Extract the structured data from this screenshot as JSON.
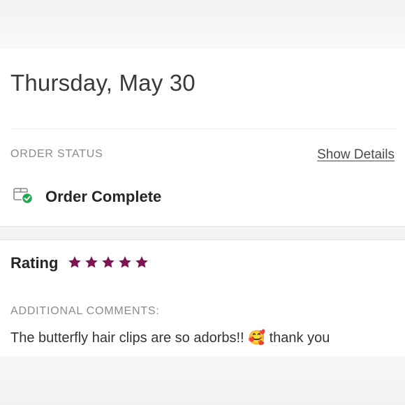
{
  "order": {
    "date": "Thursday, May 30",
    "status_label": "ORDER STATUS",
    "show_details_label": "Show Details",
    "status_text": "Order Complete",
    "status_icon": "package-check-icon"
  },
  "review": {
    "rating_label": "Rating",
    "rating": 5,
    "rating_max": 5,
    "star_color": "#7a1652",
    "comments_label": "ADDITIONAL COMMENTS:",
    "comment_text": "The butterfly hair clips are so adorbs!! 🥰 thank you"
  },
  "colors": {
    "accent": "#7a1652",
    "check_green": "#1fa84f"
  }
}
